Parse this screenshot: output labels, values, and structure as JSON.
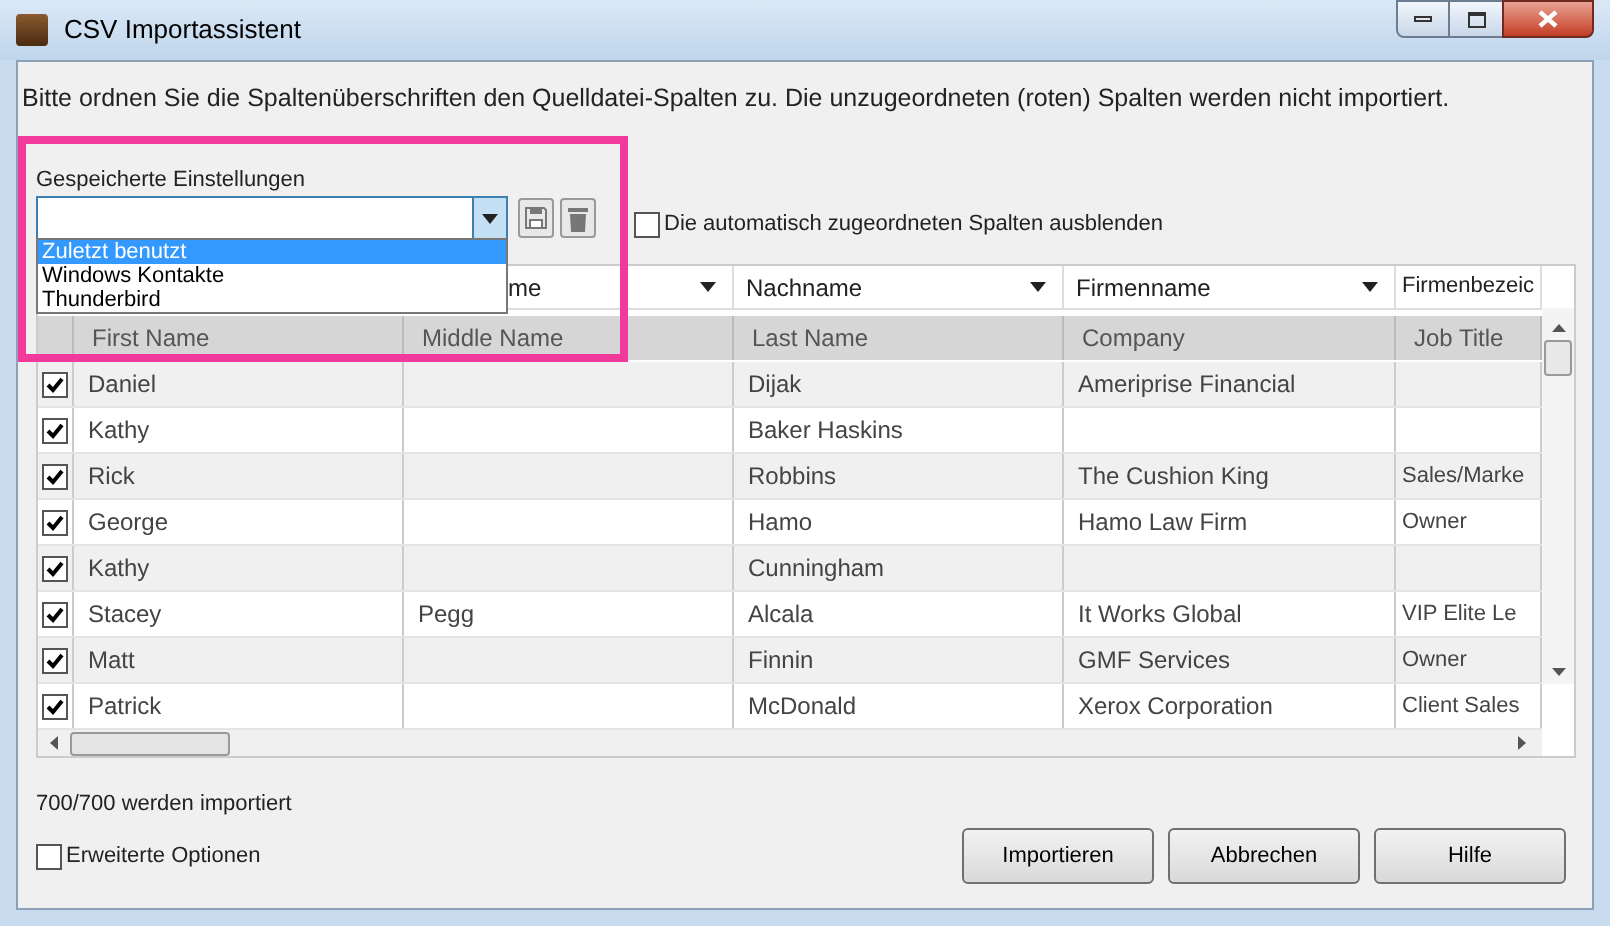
{
  "window": {
    "title": "CSV Importassistent"
  },
  "instructions": "Bitte ordnen Sie die Spaltenüberschriften den Quelldatei-Spalten zu. Die unzugeordneten (roten) Spalten werden nicht importiert.",
  "saved_settings": {
    "label": "Gespeicherte Einstellungen",
    "expanded": true,
    "options": [
      {
        "label": "Zuletzt benutzt",
        "selected": true
      },
      {
        "label": "Windows Kontakte",
        "selected": false
      },
      {
        "label": "Thunderbird",
        "selected": false
      }
    ]
  },
  "hide_auto_mapped": {
    "label": "Die automatisch zugeordneten Spalten ausblenden",
    "checked": false
  },
  "table": {
    "mapping_headers": [
      "me",
      "Nachname",
      "Firmenname",
      "Firmenbezeic"
    ],
    "source_headers": [
      "First Name",
      "Middle Name",
      "Last Name",
      "Company",
      "Job Title"
    ],
    "rows": [
      {
        "checked": true,
        "cells": [
          "Daniel",
          "",
          "Dijak",
          "Ameriprise Financial",
          ""
        ]
      },
      {
        "checked": true,
        "cells": [
          "Kathy",
          "",
          "Baker Haskins",
          "",
          ""
        ]
      },
      {
        "checked": true,
        "cells": [
          "Rick",
          "",
          "Robbins",
          "The Cushion King",
          "Sales/Marke"
        ]
      },
      {
        "checked": true,
        "cells": [
          "George",
          "",
          "Hamo",
          "Hamo Law Firm",
          "Owner"
        ]
      },
      {
        "checked": true,
        "cells": [
          "Kathy",
          "",
          "Cunningham",
          "",
          ""
        ]
      },
      {
        "checked": true,
        "cells": [
          "Stacey",
          "Pegg",
          "Alcala",
          "It Works Global",
          "VIP Elite Le"
        ]
      },
      {
        "checked": true,
        "cells": [
          "Matt",
          "",
          "Finnin",
          "GMF Services",
          "Owner"
        ]
      },
      {
        "checked": true,
        "cells": [
          "Patrick",
          "",
          "McDonald",
          "Xerox Corporation",
          "Client Sales"
        ]
      }
    ]
  },
  "status": "700/700 werden importiert",
  "advanced_options": {
    "label": "Erweiterte Optionen",
    "checked": false
  },
  "buttons": [
    "Importieren",
    "Abbrechen",
    "Hilfe"
  ]
}
